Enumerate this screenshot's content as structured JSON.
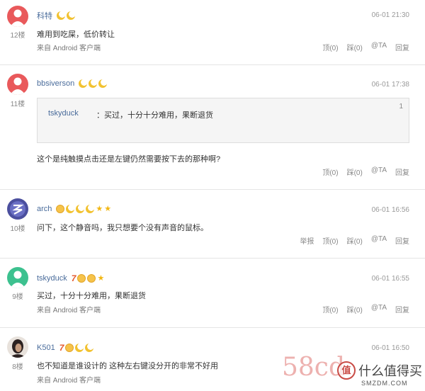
{
  "action_labels": {
    "up": "顶(0)",
    "down": "踩(0)",
    "at": "@TA",
    "reply": "回复",
    "report": "举报"
  },
  "comments": [
    {
      "floor": "12楼",
      "user": "科特",
      "time": "06-01 21:30",
      "text": "难用到吃屎，低价转让",
      "source": "来自 Android 客户端"
    },
    {
      "floor": "11楼",
      "user": "bbsiverson",
      "time": "06-01 17:38",
      "quote": {
        "user": "tskyduck",
        "text": "：买过，十分十分难用，果断退货",
        "num": "1"
      },
      "text": "这个是纯触摸点击还是左键仍然需要按下去的那种啊?"
    },
    {
      "floor": "10楼",
      "user": "arch",
      "time": "06-01 16:56",
      "text": "问下，这个静音吗，我只想要个没有声音的鼠标。"
    },
    {
      "floor": "9楼",
      "user": "tskyduck",
      "time": "06-01 16:55",
      "text": "买过，十分十分难用，果断退货",
      "source": "来自 Android 客户端"
    },
    {
      "floor": "8楼",
      "user": "K501",
      "time": "06-01 16:50",
      "text": "也不知道是谁设计的 这种左右键没分开的非常不好用",
      "source": "来自 Android 客户端"
    }
  ],
  "watermark": {
    "left": "58cd",
    "right_big": "什么值得买",
    "right_small": "SMZDM.COM",
    "right_badge": "值"
  },
  "colors": {
    "name": "#4a6c9b",
    "moon": "#f2c230",
    "star": "#f2b713",
    "seven": "#e3562a",
    "watermark": "#d9534f"
  }
}
